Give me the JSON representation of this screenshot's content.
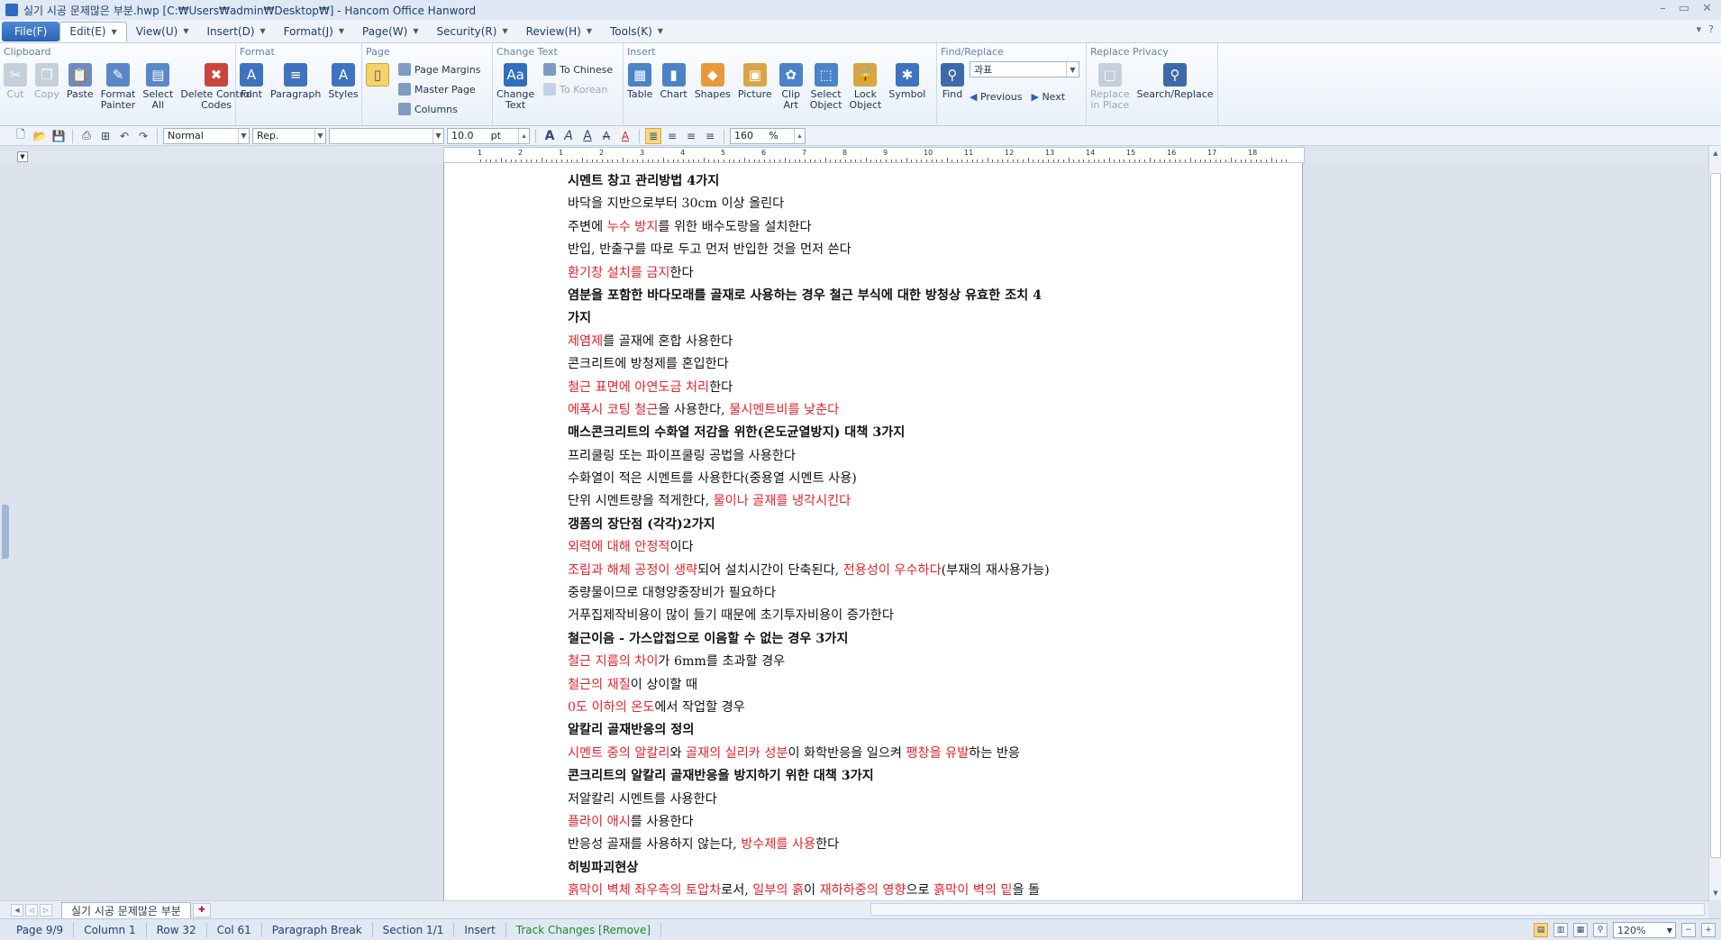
{
  "window": {
    "title": "실기 시공 문제많은 부분.hwp [C:₩Users₩admin₩Desktop₩] - Hancom Office Hanword",
    "controls": [
      "–",
      "▭",
      "✕"
    ]
  },
  "menubar": {
    "file": "File(F)",
    "items": [
      {
        "label": "Edit(E)",
        "active": true
      },
      {
        "label": "View(U)"
      },
      {
        "label": "Insert(D)"
      },
      {
        "label": "Format(J)"
      },
      {
        "label": "Page(W)"
      },
      {
        "label": "Security(R)"
      },
      {
        "label": "Review(H)"
      },
      {
        "label": "Tools(K)"
      }
    ],
    "right": [
      "▾",
      "?"
    ]
  },
  "ribbon": {
    "clipboard": {
      "title": "Clipboard",
      "cut": "Cut",
      "copy": "Copy",
      "paste": "Paste",
      "format_painter": "Format\nPainter",
      "select_all": "Select\nAll",
      "delete_control_codes": "Delete Control\nCodes"
    },
    "format": {
      "title": "Format",
      "font": "Font",
      "paragraph": "Paragraph",
      "styles": "Styles"
    },
    "page": {
      "title": "Page",
      "page_margins": "Page Margins",
      "master_page": "Master Page",
      "columns": "Columns"
    },
    "change_text": {
      "title": "Change Text",
      "change_text": "Change\nText",
      "to_chinese": "To Chinese",
      "to_korean": "To Korean"
    },
    "insert": {
      "title": "Insert",
      "table": "Table",
      "chart": "Chart",
      "shapes": "Shapes",
      "picture": "Picture",
      "clip_art": "Clip\nArt",
      "select_object": "Select\nObject",
      "lock_object": "Lock\nObject",
      "symbol": "Symbol"
    },
    "find_replace": {
      "title": "Find/Replace",
      "find": "Find",
      "search_value": "과표",
      "previous": "Previous",
      "next": "Next"
    },
    "replace_privacy": {
      "title": "Replace Privacy",
      "replace_in_place": "Replace\nin Place",
      "search_replace": "Search/Replace"
    }
  },
  "formatbar": {
    "style": "Normal",
    "font_set": "Rep.",
    "font_name": "",
    "font_size": "10.0",
    "size_unit": "pt",
    "line_spacing": "160",
    "spacing_unit": "%"
  },
  "ruler_numbers": [
    "1",
    "2",
    "1",
    "2",
    "3",
    "4",
    "5",
    "6",
    "7",
    "8",
    "9",
    "10",
    "11",
    "12",
    "13",
    "14",
    "15",
    "16",
    "17",
    "18"
  ],
  "document": {
    "lines": [
      {
        "bold": true,
        "parts": [
          {
            "t": "시멘트 창고 관리방법 4가지"
          }
        ]
      },
      {
        "parts": [
          {
            "t": "바닥을 지반으로부터 30cm 이상 올린다"
          }
        ]
      },
      {
        "parts": [
          {
            "t": "주변에 "
          },
          {
            "t": "누수 방지",
            "red": true
          },
          {
            "t": "를 위한 배수도랑을 설치한다"
          }
        ]
      },
      {
        "parts": [
          {
            "t": "반입, 반출구를 따로 두고 먼저 반입한 것을 먼저 쓴다"
          }
        ]
      },
      {
        "parts": [
          {
            "t": "환기창 설치를 금지",
            "red": true
          },
          {
            "t": "한다"
          }
        ]
      },
      {
        "bold": true,
        "parts": [
          {
            "t": "염분을 포함한 바다모래를 골재로 사용하는 경우 철근 부식에 대한 방청상 유효한 조치 4"
          }
        ]
      },
      {
        "bold": true,
        "parts": [
          {
            "t": "가지"
          }
        ]
      },
      {
        "parts": [
          {
            "t": "제염제를 골재에 혼합 사용한다",
            "red": true,
            "redPrefix": "제염제"
          }
        ]
      },
      {
        "parts": [
          {
            "t": "콘크리트에 방청제를 혼입한다"
          }
        ]
      },
      {
        "parts": [
          {
            "t": "철근 표면에 아연도금 처리",
            "red": true
          },
          {
            "t": "한다"
          }
        ]
      },
      {
        "parts": [
          {
            "t": "에폭시 코팅 철근",
            "red": true
          },
          {
            "t": "을 사용한다, "
          },
          {
            "t": "물시멘트비를 낮춘다",
            "red": true
          }
        ]
      },
      {
        "bold": true,
        "parts": [
          {
            "t": "매스콘크리트의 수화열 저감을 위한(온도균열방지) 대책 3가지"
          }
        ]
      },
      {
        "parts": [
          {
            "t": "프리쿨링 또는 파이프쿨링 공법을 사용한다"
          }
        ]
      },
      {
        "parts": [
          {
            "t": "수화열이 적은 시멘트를 사용한다(중용열 시멘트 사용)"
          }
        ]
      },
      {
        "parts": [
          {
            "t": "단위 시멘트량을 적게한다, "
          },
          {
            "t": "물이나 골재를 냉각시킨다",
            "red": true
          }
        ]
      },
      {
        "bold": true,
        "parts": [
          {
            "t": "갱폼의 장단점 (각각)2가지"
          }
        ]
      },
      {
        "parts": [
          {
            "t": "외력에 대해 안정적",
            "red": true
          },
          {
            "t": "이다"
          }
        ]
      },
      {
        "parts": [
          {
            "t": "조립과 해체 공정이 생략",
            "red": true
          },
          {
            "t": "되어 설치시간이 단축된다, "
          },
          {
            "t": "전용성이 우수하다",
            "red": true
          },
          {
            "t": "(부재의 재사용가능)"
          }
        ]
      },
      {
        "parts": [
          {
            "t": "중량물이므로 대형양중장비가 필요하다"
          }
        ]
      },
      {
        "parts": [
          {
            "t": "거푸집제작비용이 많이 들기 때문에 초기투자비용이 증가한다"
          }
        ]
      },
      {
        "bold": true,
        "parts": [
          {
            "t": "철근이음 - 가스압접으로 이음할 수 없는 경우 3가지"
          }
        ]
      },
      {
        "parts": [
          {
            "t": "철근 지름의 차이",
            "red": true
          },
          {
            "t": "가 6mm를 초과할 경우"
          }
        ]
      },
      {
        "parts": [
          {
            "t": "철근의 재질",
            "red": true
          },
          {
            "t": "이 상이할 때"
          }
        ]
      },
      {
        "parts": [
          {
            "t": "0도 이하의 온도",
            "red": true
          },
          {
            "t": "에서 작업할 경우"
          }
        ]
      },
      {
        "bold": true,
        "parts": [
          {
            "t": "알칼리 골재반응의 정의"
          }
        ]
      },
      {
        "parts": [
          {
            "t": "시멘트 중의 알칼리",
            "red": true
          },
          {
            "t": "와 "
          },
          {
            "t": "골재의 실리카 성분",
            "red": true
          },
          {
            "t": "이 화학반응을 일으켜 "
          },
          {
            "t": "팽창을 유발",
            "red": true
          },
          {
            "t": "하는 반응"
          }
        ]
      },
      {
        "bold": true,
        "parts": [
          {
            "t": "콘크리트의 알칼리 골재반응을 방지하기 위한 대책 3가지"
          }
        ]
      },
      {
        "parts": [
          {
            "t": "저알칼리 시멘트를 사용한다"
          }
        ]
      },
      {
        "parts": [
          {
            "t": "플라이 애시",
            "red": true
          },
          {
            "t": "를 사용한다"
          }
        ]
      },
      {
        "parts": [
          {
            "t": "반응성 골재를 사용하지 않는다, "
          },
          {
            "t": "방수제를 사용",
            "red": true
          },
          {
            "t": "한다"
          }
        ]
      },
      {
        "bold": true,
        "parts": [
          {
            "t": "히빙파괴현상"
          }
        ]
      },
      {
        "parts": [
          {
            "t": "흙막이 벽체 좌우측의 토압차",
            "red": true
          },
          {
            "t": "로서, "
          },
          {
            "t": "일부의 흙",
            "red": true
          },
          {
            "t": "이 "
          },
          {
            "t": "재하하중의 영향",
            "red": true
          },
          {
            "t": "으로 "
          },
          {
            "t": "흙막이 벽의 밑",
            "red": true
          },
          {
            "t": "을 돌"
          }
        ]
      }
    ]
  },
  "tabs": {
    "doc_tab": "실기 시공 문제많은 부분"
  },
  "statusbar": {
    "page": "Page 9/9",
    "column": "Column 1",
    "row": "Row 32",
    "col": "Col 61",
    "break": "Paragraph Break",
    "section": "Section 1/1",
    "mode": "Insert",
    "track": "Track Changes [Remove]",
    "zoom": "120%"
  },
  "colors": {
    "accent": "#2a63b3",
    "red_text": "#e4232c",
    "track_green": "#1b8a2b"
  }
}
